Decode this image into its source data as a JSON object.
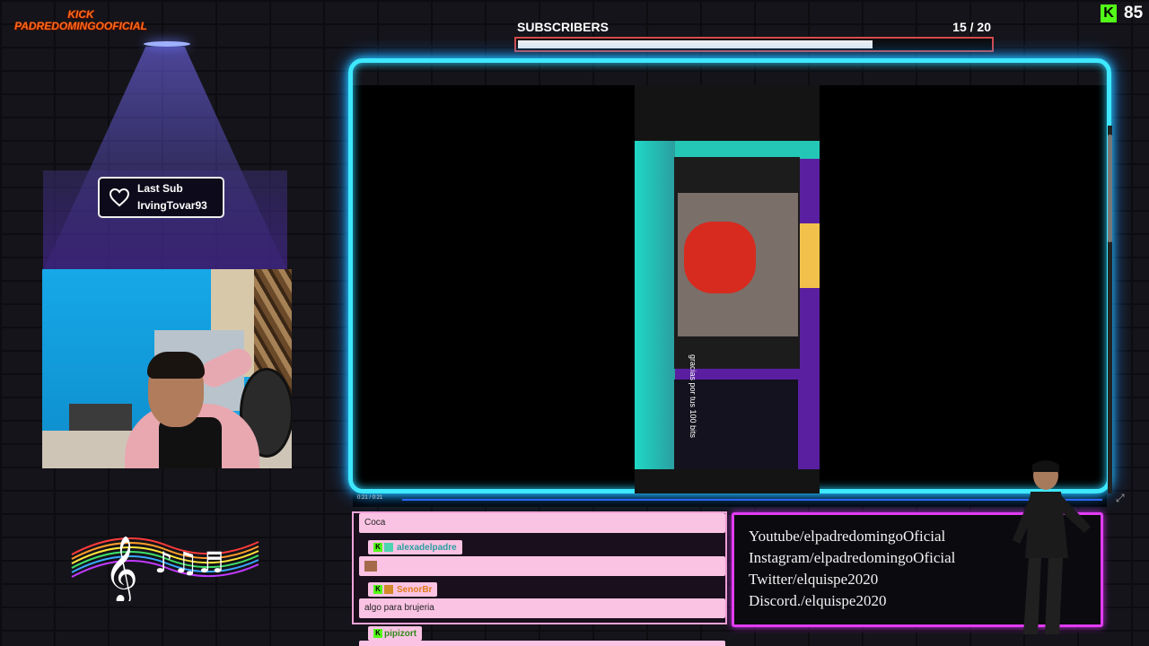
{
  "channel_logo": {
    "line1": "KICK",
    "line2": "PADREDOMINGOOFICIAL"
  },
  "last_sub": {
    "title": "Last Sub",
    "name": "IrvingTovar93"
  },
  "subscribers": {
    "label": "SUBSCRIBERS",
    "current": 15,
    "goal": 20,
    "count_text": "15  / 20",
    "fraction": 0.75
  },
  "viewers": {
    "platform_icon": "kick-logo-icon",
    "count": "85",
    "accent": "#53fc18"
  },
  "video": {
    "time": "0:21 / 0:21",
    "clip_text": "gracias por tus 100 bits"
  },
  "chat": {
    "messages": [
      {
        "text": "Coca"
      },
      {
        "user": "alexadelpadre",
        "text": ""
      },
      {
        "user": "SenorBr",
        "text": "algo para brujeria"
      },
      {
        "user": "pipizort",
        "text": ""
      }
    ]
  },
  "socials": [
    "Youtube/elpadredomingoOficial",
    "Instagram/elpadredomingoOficial",
    "Twitter/elquispe2020",
    "Discord./elquispe2020"
  ],
  "colors": {
    "neon_frame": "#3ee8ff",
    "socials_border": "#e13df2",
    "chat_border": "#f0a4d8",
    "subs_bar_border": "#d94a4a"
  }
}
